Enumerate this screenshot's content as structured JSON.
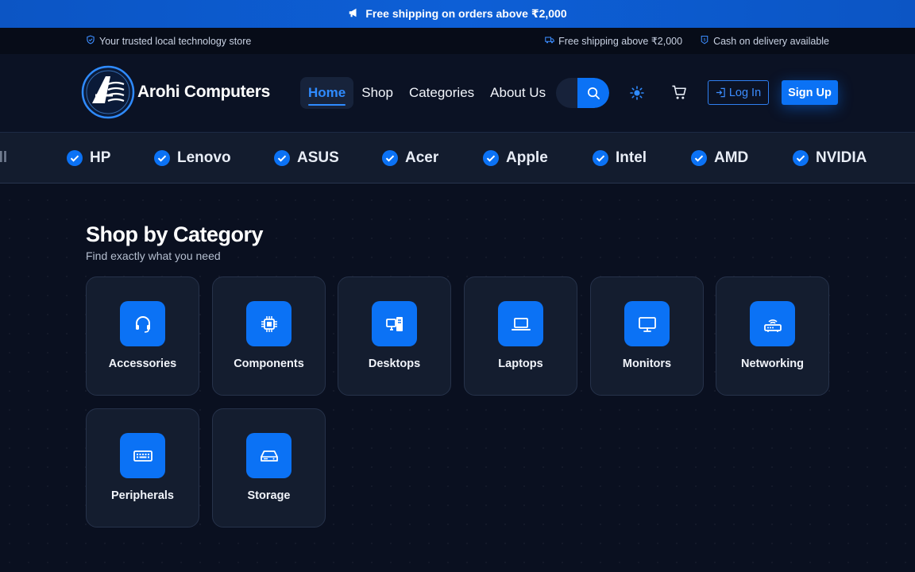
{
  "promo": {
    "text": "Free shipping on orders above ₹2,000",
    "icon": "megaphone-icon"
  },
  "info": {
    "tagline": "Your trusted local technology store",
    "shipping": "Free shipping above ₹2,000",
    "cod": "Cash on delivery available"
  },
  "header": {
    "brand": "Arohi Computers",
    "nav": [
      "Home",
      "Shop",
      "Categories",
      "About Us"
    ],
    "active_nav": "Home",
    "search_placeholder": "",
    "login": "Log In",
    "signup": "Sign Up"
  },
  "brands": {
    "cut_label": "ell",
    "items": [
      "HP",
      "Lenovo",
      "ASUS",
      "Acer",
      "Apple",
      "Intel",
      "AMD",
      "NVIDIA"
    ]
  },
  "section": {
    "title": "Shop by Category",
    "subtitle": "Find exactly what you need",
    "categories": [
      {
        "label": "Accessories",
        "icon": "headset-icon"
      },
      {
        "label": "Components",
        "icon": "chip-icon"
      },
      {
        "label": "Desktops",
        "icon": "desktop-icon"
      },
      {
        "label": "Laptops",
        "icon": "laptop-icon"
      },
      {
        "label": "Monitors",
        "icon": "monitor-icon"
      },
      {
        "label": "Networking",
        "icon": "router-icon"
      },
      {
        "label": "Peripherals",
        "icon": "keyboard-icon"
      },
      {
        "label": "Storage",
        "icon": "drive-icon"
      }
    ]
  },
  "colors": {
    "accent": "#0b72f5",
    "background": "#0a1020",
    "card": "#141d2f"
  }
}
